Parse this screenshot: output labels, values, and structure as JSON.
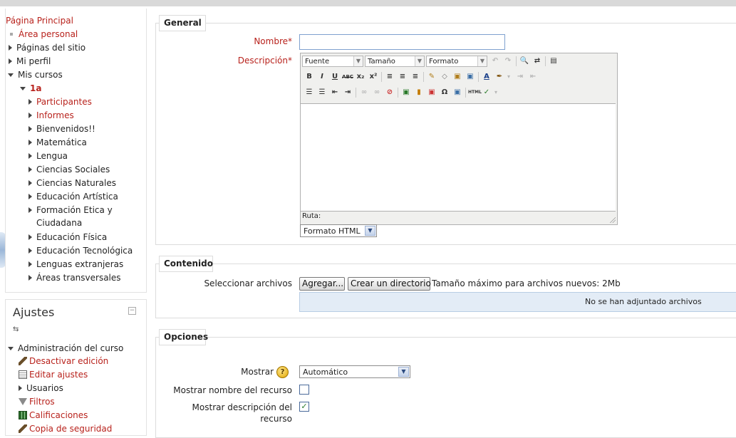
{
  "navigation": {
    "home": "Página Principal",
    "dashboard": "Área personal",
    "site_pages": "Páginas del sitio",
    "my_profile": "Mi perfil",
    "my_courses": "Mis cursos",
    "course": "1a",
    "participants": "Participantes",
    "reports": "Informes",
    "sections": [
      "Bienvenidos!!",
      "Matemática",
      "Lengua",
      "Ciencias Sociales",
      "Ciencias Naturales",
      "Educación Artística",
      "Formación Etica y",
      "Ciudadana",
      "Educación Física",
      "Educación Tecnológica",
      "Lenguas extranjeras",
      "Áreas transversales"
    ]
  },
  "settings": {
    "title": "Ajustes",
    "collapse_symbol": "−",
    "dock_symbol": "⇆",
    "course_admin": "Administración del curso",
    "turn_editing_off": "Desactivar edición",
    "edit_settings": "Editar ajustes",
    "users": "Usuarios",
    "filters": "Filtros",
    "grades": "Calificaciones",
    "backup": "Copia de seguridad"
  },
  "general": {
    "legend": "General",
    "name_label": "Nombre",
    "name_value": "",
    "description_label": "Descripción",
    "required_mark": "*",
    "editor": {
      "font_select": "Fuente",
      "size_select": "Tamaño",
      "format_select": "Formato",
      "row1_buttons": [
        "↶",
        "↷",
        "🔍",
        "⇄",
        "▤"
      ],
      "row2_buttons": [
        "B",
        "I",
        "U",
        "ABC",
        "x₂",
        "x²",
        "≡",
        "≡",
        "≡",
        "✎",
        "◇",
        "▣",
        "▣",
        "A",
        "✒",
        "▾",
        "⇥",
        "⇤"
      ],
      "row3_buttons": [
        "☰",
        "☰",
        "⇤",
        "⇥",
        "∞",
        "∞",
        "⊘",
        "▣",
        "▮",
        "▣",
        "Ω",
        "▣",
        "HTML",
        "✓",
        "▾"
      ],
      "path_label": "Ruta:"
    },
    "format_select": "Formato HTML"
  },
  "content": {
    "legend": "Contenido",
    "select_files_label": "Seleccionar archivos",
    "add_button": "Agregar...",
    "create_dir_button": "Crear un directorio",
    "max_size_text": "Tamaño máximo para archivos nuevos: 2Mb",
    "no_files_text": "No se han adjuntado archivos"
  },
  "options": {
    "legend": "Opciones",
    "display_label": "Mostrar",
    "display_value": "Automático",
    "show_name_label": "Mostrar nombre del recurso",
    "show_name_checked": false,
    "show_desc_label_line1": "Mostrar descripción del",
    "show_desc_label_line2": "recurso",
    "show_desc_checked": true,
    "check_mark": "✓",
    "help_symbol": "?"
  }
}
